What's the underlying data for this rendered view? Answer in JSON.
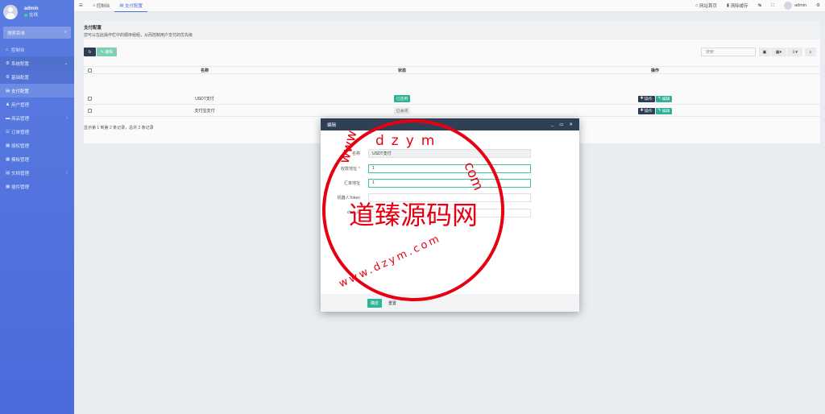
{
  "sidebar": {
    "user": {
      "name": "admin",
      "status": "在线"
    },
    "search_placeholder": "搜索菜单",
    "items": [
      {
        "label": "控制台",
        "icon": "dashboard-icon"
      },
      {
        "label": "系统配置",
        "icon": "gear-icon",
        "expanded": true
      },
      {
        "label": "基础配置",
        "icon": "gear-icon"
      },
      {
        "label": "支付配置",
        "icon": "table-icon"
      },
      {
        "label": "用户管理",
        "icon": "user-icon"
      },
      {
        "label": "商品管理",
        "icon": "cart-icon"
      },
      {
        "label": "订单管理",
        "icon": "list-icon"
      },
      {
        "label": "授权管理",
        "icon": "key-icon"
      },
      {
        "label": "模板管理",
        "icon": "template-icon"
      },
      {
        "label": "文档管理",
        "icon": "doc-icon"
      },
      {
        "label": "插件管理",
        "icon": "plugin-icon"
      }
    ]
  },
  "topbar": {
    "tabs": [
      "控制台",
      "支付配置"
    ],
    "right": {
      "home": "网站首页",
      "clear": "清除缓存",
      "user": "admin"
    }
  },
  "page": {
    "title": "支付配置",
    "desc": "您可以在此操作栏中的顺序组组，从而控制用户支付的优先级",
    "toolbar": {
      "edit": "编辑",
      "search_placeholder": "搜索"
    },
    "columns": [
      "名称",
      "状态",
      "操作"
    ],
    "rows": [
      {
        "name": "USDT支付",
        "status": "已启用",
        "status_on": true,
        "btn_config": "操作",
        "btn_edit": "编辑"
      },
      {
        "name": "支付宝支付",
        "status": "已关闭",
        "status_on": false,
        "btn_config": "操作",
        "btn_edit": "编辑"
      }
    ],
    "pagination": "显示第 1 到第 2 条记录，总共 2 条记录"
  },
  "modal": {
    "title": "编辑",
    "fields": [
      {
        "label": "名称",
        "value": "USDT支付",
        "readonly": true
      },
      {
        "label": "收款地址",
        "value": "1",
        "required": true
      },
      {
        "label": "汇率地址",
        "value": "1"
      },
      {
        "label": "机器人Token",
        "value": ""
      },
      {
        "label": "chat_id",
        "value": ""
      }
    ],
    "confirm": "确定",
    "reset": "重置"
  },
  "stamp": {
    "center": "道臻源码网",
    "ring_top": "dzym",
    "ring_left": "www",
    "ring_right": "com",
    "ring_bottom": "www.dzym.com"
  },
  "colors": {
    "sidebar": "#4e6ee0",
    "accent": "#2fb597",
    "modal_head": "#2e3f56",
    "stamp": "#e60012"
  }
}
